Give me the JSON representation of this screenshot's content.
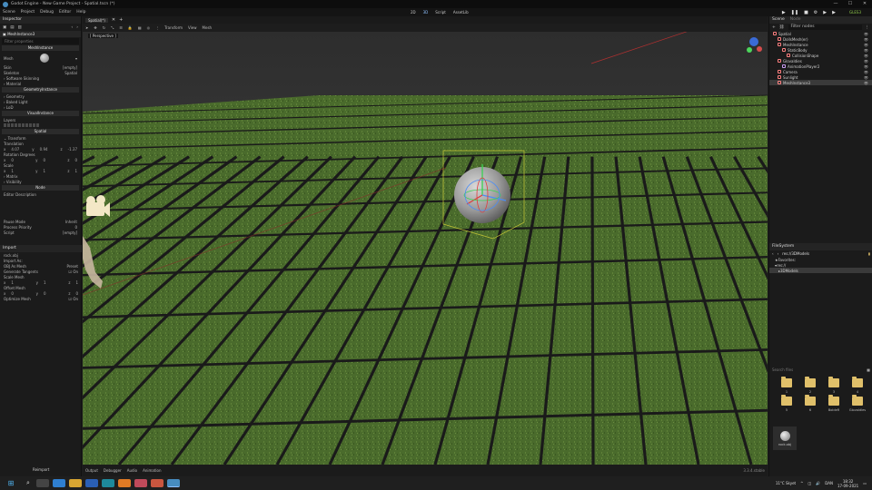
{
  "window": {
    "title": "Godot Engine - New Game Project - Spatial.tscn (*)",
    "minimize": "—",
    "maximize": "☐",
    "close": "✕"
  },
  "menubar": {
    "items": [
      "Scene",
      "Project",
      "Debug",
      "Editor",
      "Help"
    ],
    "workspaces": [
      "2D",
      "3D",
      "Script",
      "AssetLib"
    ],
    "play": [
      "▶",
      "❚❚",
      "■",
      "⚙",
      "▶",
      "▶"
    ],
    "renderer": "GLES3"
  },
  "inspector": {
    "tab": "Inspector",
    "tab_import": "Import",
    "filter_placeholder": "Filter properties",
    "object_name": "MeshInstance3",
    "resource_name": "MeshInstance",
    "mesh_label": "Mesh",
    "skin_label": "Skin",
    "skin_value": "[empty]",
    "skeleton_label": "Skeleton",
    "skeleton_value": "Spatial",
    "sections": [
      "Software Skinning",
      "Material",
      "Geometry",
      "Baked Light",
      "LoD"
    ],
    "geometry_instance": "GeometryInstance",
    "visual_instance": "VisualInstance",
    "layers_label": "Layers",
    "spatial_label": "Spatial",
    "transform_label": "Transform",
    "translation_label": "Translation",
    "translation": [
      "4.07",
      "0.94",
      "-1.37"
    ],
    "rotation_label": "Rotation Degrees",
    "rotation": [
      "0",
      "0",
      "0"
    ],
    "scale_label": "Scale",
    "scale": [
      "1",
      "1",
      "1"
    ],
    "matrix_label": "Matrix",
    "visibility_label": "Visibility",
    "node_label": "Node",
    "editor_desc": "Editor Description",
    "pause_mode_label": "Pause Mode",
    "pause_mode_value": "Inherit",
    "process_priority_label": "Process Priority",
    "process_priority_value": "0",
    "script_label": "Script",
    "script_value": "[empty]"
  },
  "import_panel": {
    "tab": "Import",
    "file": "rock.obj",
    "import_as_label": "Import As:",
    "import_as_value": "OBJ As Mesh",
    "preset": "Preset",
    "generate_tangents_label": "Generate Tangents",
    "generate_tangents_value": "On",
    "scale_mesh_label": "Scale Mesh",
    "scale_mesh": [
      "1",
      "1",
      "1"
    ],
    "offset_mesh_label": "Offset Mesh",
    "offset_mesh": [
      "0",
      "0",
      "0"
    ],
    "optimize_mesh_label": "Optimize Mesh",
    "optimize_mesh_value": "On",
    "reimport": "Reimport"
  },
  "viewport": {
    "scene_tab": "Spatial(*)",
    "toolbar": [
      "Transform",
      "View",
      "Mesh"
    ],
    "perspective_label": "[ Perspective ]"
  },
  "bottom_tabs": [
    "Output",
    "Debugger",
    "Audio",
    "Animation"
  ],
  "version": "3.3.4.stable",
  "scene_dock": {
    "tab": "Scene",
    "tab2": "Node",
    "filter_placeholder": "Filter nodes",
    "nodes": [
      {
        "name": "Spatial",
        "indent": 0,
        "color": "#fc7f7f"
      },
      {
        "name": "DollsMesh(er)",
        "indent": 1,
        "color": "#fc7f7f"
      },
      {
        "name": "MeshInstance",
        "indent": 1,
        "color": "#fc7f7f"
      },
      {
        "name": "StaticBody",
        "indent": 2,
        "color": "#fc7f7f"
      },
      {
        "name": "CollisionShape",
        "indent": 3,
        "color": "#fc7f7f"
      },
      {
        "name": "Glovaldies",
        "indent": 1,
        "color": "#fc7f7f"
      },
      {
        "name": "AnimationPlayer2",
        "indent": 2,
        "color": "#c89bf0"
      },
      {
        "name": "Camera",
        "indent": 1,
        "color": "#fc7f7f"
      },
      {
        "name": "Sunlight",
        "indent": 1,
        "color": "#fc7f7f"
      },
      {
        "name": "MeshInstance3",
        "indent": 1,
        "color": "#fc7f7f"
      }
    ]
  },
  "filesystem": {
    "tab": "FileSystem",
    "path": "res://3DModels",
    "favorites": "Favorites:",
    "root": "res://",
    "folder": "3DModels",
    "search_placeholder": "Search files",
    "grid_items": [
      "1",
      "2",
      "3",
      "4",
      "5",
      "6",
      "BoldeR",
      "GlovaIdles"
    ],
    "file": "rock.obj"
  },
  "taskbar": {
    "weather": "11°C Skyet",
    "lang": "DAN",
    "time": "18:32",
    "date": "17-09-2021"
  },
  "colors": {
    "accent": "#478cbf",
    "grass": "#4d6e2f",
    "folder": "#e0c06a"
  }
}
